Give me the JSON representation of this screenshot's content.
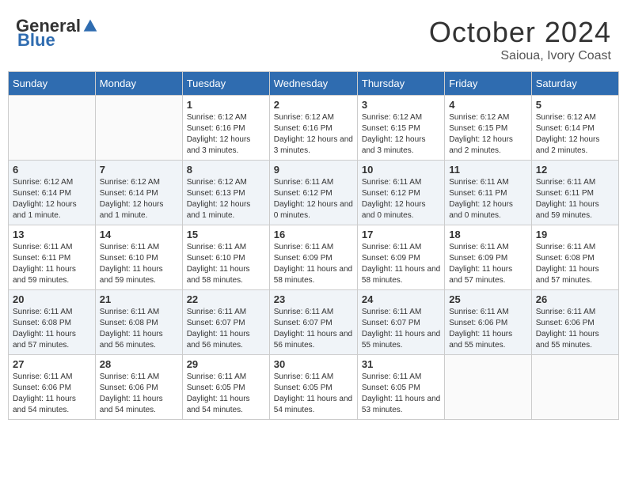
{
  "header": {
    "logo_general": "General",
    "logo_blue": "Blue",
    "month_title": "October 2024",
    "subtitle": "Saioua, Ivory Coast"
  },
  "days_of_week": [
    "Sunday",
    "Monday",
    "Tuesday",
    "Wednesday",
    "Thursday",
    "Friday",
    "Saturday"
  ],
  "weeks": [
    [
      {
        "day": "",
        "info": ""
      },
      {
        "day": "",
        "info": ""
      },
      {
        "day": "1",
        "info": "Sunrise: 6:12 AM\nSunset: 6:16 PM\nDaylight: 12 hours and 3 minutes."
      },
      {
        "day": "2",
        "info": "Sunrise: 6:12 AM\nSunset: 6:16 PM\nDaylight: 12 hours and 3 minutes."
      },
      {
        "day": "3",
        "info": "Sunrise: 6:12 AM\nSunset: 6:15 PM\nDaylight: 12 hours and 3 minutes."
      },
      {
        "day": "4",
        "info": "Sunrise: 6:12 AM\nSunset: 6:15 PM\nDaylight: 12 hours and 2 minutes."
      },
      {
        "day": "5",
        "info": "Sunrise: 6:12 AM\nSunset: 6:14 PM\nDaylight: 12 hours and 2 minutes."
      }
    ],
    [
      {
        "day": "6",
        "info": "Sunrise: 6:12 AM\nSunset: 6:14 PM\nDaylight: 12 hours and 1 minute."
      },
      {
        "day": "7",
        "info": "Sunrise: 6:12 AM\nSunset: 6:14 PM\nDaylight: 12 hours and 1 minute."
      },
      {
        "day": "8",
        "info": "Sunrise: 6:12 AM\nSunset: 6:13 PM\nDaylight: 12 hours and 1 minute."
      },
      {
        "day": "9",
        "info": "Sunrise: 6:11 AM\nSunset: 6:12 PM\nDaylight: 12 hours and 0 minutes."
      },
      {
        "day": "10",
        "info": "Sunrise: 6:11 AM\nSunset: 6:12 PM\nDaylight: 12 hours and 0 minutes."
      },
      {
        "day": "11",
        "info": "Sunrise: 6:11 AM\nSunset: 6:11 PM\nDaylight: 12 hours and 0 minutes."
      },
      {
        "day": "12",
        "info": "Sunrise: 6:11 AM\nSunset: 6:11 PM\nDaylight: 11 hours and 59 minutes."
      }
    ],
    [
      {
        "day": "13",
        "info": "Sunrise: 6:11 AM\nSunset: 6:11 PM\nDaylight: 11 hours and 59 minutes."
      },
      {
        "day": "14",
        "info": "Sunrise: 6:11 AM\nSunset: 6:10 PM\nDaylight: 11 hours and 59 minutes."
      },
      {
        "day": "15",
        "info": "Sunrise: 6:11 AM\nSunset: 6:10 PM\nDaylight: 11 hours and 58 minutes."
      },
      {
        "day": "16",
        "info": "Sunrise: 6:11 AM\nSunset: 6:09 PM\nDaylight: 11 hours and 58 minutes."
      },
      {
        "day": "17",
        "info": "Sunrise: 6:11 AM\nSunset: 6:09 PM\nDaylight: 11 hours and 58 minutes."
      },
      {
        "day": "18",
        "info": "Sunrise: 6:11 AM\nSunset: 6:09 PM\nDaylight: 11 hours and 57 minutes."
      },
      {
        "day": "19",
        "info": "Sunrise: 6:11 AM\nSunset: 6:08 PM\nDaylight: 11 hours and 57 minutes."
      }
    ],
    [
      {
        "day": "20",
        "info": "Sunrise: 6:11 AM\nSunset: 6:08 PM\nDaylight: 11 hours and 57 minutes."
      },
      {
        "day": "21",
        "info": "Sunrise: 6:11 AM\nSunset: 6:08 PM\nDaylight: 11 hours and 56 minutes."
      },
      {
        "day": "22",
        "info": "Sunrise: 6:11 AM\nSunset: 6:07 PM\nDaylight: 11 hours and 56 minutes."
      },
      {
        "day": "23",
        "info": "Sunrise: 6:11 AM\nSunset: 6:07 PM\nDaylight: 11 hours and 56 minutes."
      },
      {
        "day": "24",
        "info": "Sunrise: 6:11 AM\nSunset: 6:07 PM\nDaylight: 11 hours and 55 minutes."
      },
      {
        "day": "25",
        "info": "Sunrise: 6:11 AM\nSunset: 6:06 PM\nDaylight: 11 hours and 55 minutes."
      },
      {
        "day": "26",
        "info": "Sunrise: 6:11 AM\nSunset: 6:06 PM\nDaylight: 11 hours and 55 minutes."
      }
    ],
    [
      {
        "day": "27",
        "info": "Sunrise: 6:11 AM\nSunset: 6:06 PM\nDaylight: 11 hours and 54 minutes."
      },
      {
        "day": "28",
        "info": "Sunrise: 6:11 AM\nSunset: 6:06 PM\nDaylight: 11 hours and 54 minutes."
      },
      {
        "day": "29",
        "info": "Sunrise: 6:11 AM\nSunset: 6:05 PM\nDaylight: 11 hours and 54 minutes."
      },
      {
        "day": "30",
        "info": "Sunrise: 6:11 AM\nSunset: 6:05 PM\nDaylight: 11 hours and 54 minutes."
      },
      {
        "day": "31",
        "info": "Sunrise: 6:11 AM\nSunset: 6:05 PM\nDaylight: 11 hours and 53 minutes."
      },
      {
        "day": "",
        "info": ""
      },
      {
        "day": "",
        "info": ""
      }
    ]
  ]
}
